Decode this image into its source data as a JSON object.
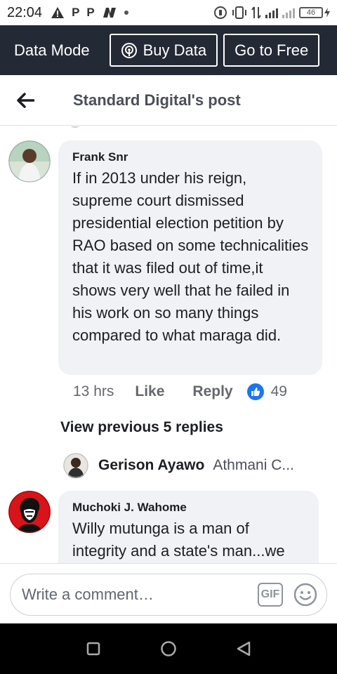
{
  "status_bar": {
    "time": "22:04",
    "left_icons": [
      "warning-icon",
      "p-icon",
      "p-icon",
      "news-icon",
      "dot-icon"
    ],
    "left_glyphs": [
      "P",
      "P"
    ],
    "battery_level": "46"
  },
  "data_bar": {
    "mode_label": "Data Mode",
    "buy_data_label": "Buy Data",
    "go_free_label": "Go to Free"
  },
  "header": {
    "title": "Standard Digital's post"
  },
  "comments": [
    {
      "author": "Frank Snr",
      "text": "If in 2013 under his reign, supreme court dismissed presidential election petition by RAO based on some technicalities that it was filed out of time,it shows very well that he failed in his work on so many things compared to what maraga did.",
      "time": "13 hrs",
      "like_label": "Like",
      "reply_label": "Reply",
      "like_count": "49"
    },
    {
      "author": "Muchoki J. Wahome",
      "text": "Willy mutunga is a man of integrity and a state's man...we"
    }
  ],
  "view_previous": "View previous 5 replies",
  "reply_preview": {
    "name": "Gerison Ayawo",
    "text": "Athmani C..."
  },
  "composer": {
    "placeholder": "Write a comment…",
    "gif_label": "GIF"
  },
  "colors": {
    "data_bar_bg": "#232a35",
    "like_blue": "#1877f2",
    "bubble_bg": "#f0f2f5"
  }
}
